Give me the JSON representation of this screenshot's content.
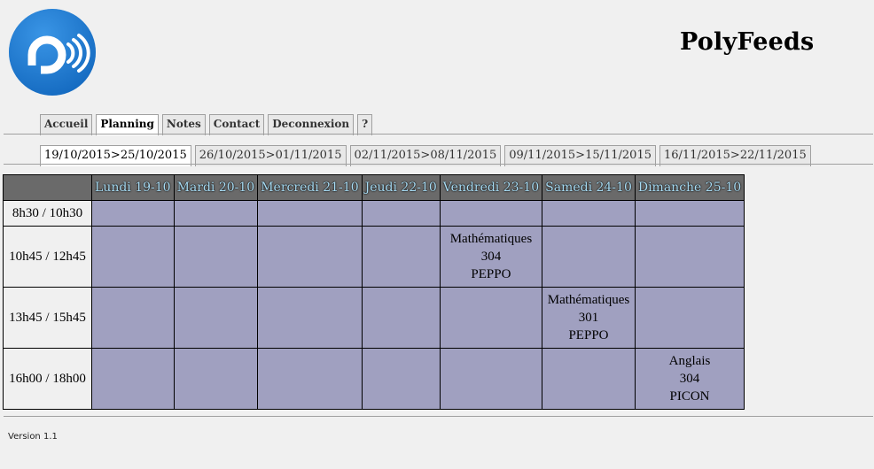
{
  "app": {
    "title": "PolyFeeds"
  },
  "nav": {
    "tabs": [
      {
        "label": "Accueil"
      },
      {
        "label": "Planning"
      },
      {
        "label": "Notes"
      },
      {
        "label": "Contact"
      },
      {
        "label": "Deconnexion"
      },
      {
        "label": "?"
      }
    ],
    "active_index": 1
  },
  "weeks": {
    "tabs": [
      {
        "label": "19/10/2015>25/10/2015"
      },
      {
        "label": "26/10/2015>01/11/2015"
      },
      {
        "label": "02/11/2015>08/11/2015"
      },
      {
        "label": "09/11/2015>15/11/2015"
      },
      {
        "label": "16/11/2015>22/11/2015"
      }
    ],
    "active_index": 0
  },
  "planning": {
    "days": [
      "Lundi 19-10",
      "Mardi 20-10",
      "Mercredi 21-10",
      "Jeudi 22-10",
      "Vendredi 23-10",
      "Samedi 24-10",
      "Dimanche 25-10"
    ],
    "slots": [
      "8h30 / 10h30",
      "10h45 / 12h45",
      "13h45 / 15h45",
      "16h00 / 18h00"
    ],
    "courses": {
      "fri_slot2": {
        "subject": "Mathématiques",
        "room": "304",
        "teacher": "PEPPO"
      },
      "sat_slot3": {
        "subject": "Mathématiques",
        "room": "301",
        "teacher": "PEPPO"
      },
      "sun_slot4": {
        "subject": "Anglais",
        "room": "304",
        "teacher": "PICON"
      }
    }
  },
  "footer": {
    "version": "Version 1.1"
  },
  "colors": {
    "header_bg": "#6a6a6a",
    "header_text": "#a8dcf4",
    "cell_bg": "#a0a0c0",
    "logo_blue": "#1d7ed8"
  }
}
